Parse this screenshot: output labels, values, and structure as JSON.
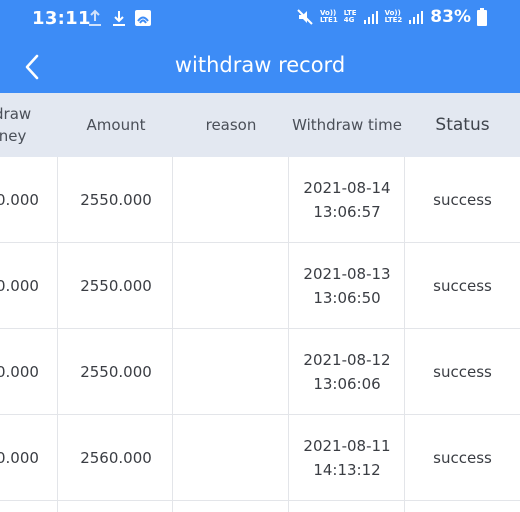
{
  "status_bar": {
    "time": "13:11",
    "net1_top": "Vo))",
    "net1_bottom": "LTE1",
    "lte_top": "LTE",
    "lte_bottom": "4G",
    "net2_top": "Vo))",
    "net2_bottom": "LTE2",
    "battery": "83%"
  },
  "app_bar": {
    "title": "withdraw record",
    "back_icon": "chevron-left-icon"
  },
  "table": {
    "headers": {
      "col1_line1": "draw",
      "col1_line2": "ney",
      "amount": "Amount",
      "reason": "reason",
      "time": "Withdraw time",
      "status": "Status"
    },
    "rows": [
      {
        "money": "0.000",
        "amount": "2550.000",
        "reason": "",
        "date": "2021-08-14",
        "time": "13:06:57",
        "status": "success"
      },
      {
        "money": "0.000",
        "amount": "2550.000",
        "reason": "",
        "date": "2021-08-13",
        "time": "13:06:50",
        "status": "success"
      },
      {
        "money": "0.000",
        "amount": "2550.000",
        "reason": "",
        "date": "2021-08-12",
        "time": "13:06:06",
        "status": "success"
      },
      {
        "money": "0.000",
        "amount": "2560.000",
        "reason": "",
        "date": "2021-08-11",
        "time": "14:13:12",
        "status": "success"
      }
    ]
  },
  "colors": {
    "primary": "#3d8cf6",
    "header_bg": "#e3e8f1"
  }
}
